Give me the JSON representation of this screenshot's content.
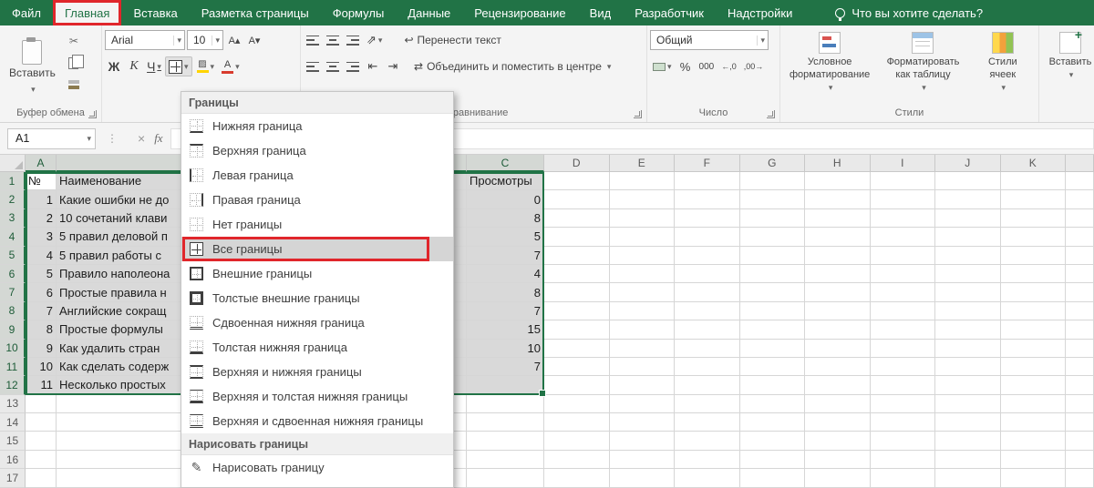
{
  "colors": {
    "excel_green": "#217346",
    "annotation_red": "#e0262b",
    "selection_gray": "#d9d9d9",
    "menu_selected_gray": "#d5d5d5"
  },
  "tabs": [
    {
      "label": "Файл"
    },
    {
      "label": "Главная",
      "active": true
    },
    {
      "label": "Вставка"
    },
    {
      "label": "Разметка страницы"
    },
    {
      "label": "Формулы"
    },
    {
      "label": "Данные"
    },
    {
      "label": "Рецензирование"
    },
    {
      "label": "Вид"
    },
    {
      "label": "Разработчик"
    },
    {
      "label": "Надстройки"
    }
  ],
  "tellme": {
    "label": "Что вы хотите сделать?",
    "icon": "lightbulb"
  },
  "icons": {
    "cut": "✂",
    "grow_font": "А▴",
    "shrink_font": "А▾",
    "orientation": "⇗",
    "wrap": "↩",
    "merge": "⇄",
    "indent_decrease": "⇤",
    "indent_increase": "⇥",
    "increase_decimal": "←,0",
    "decrease_decimal": ",00→",
    "cancel": "×",
    "dots": "⋮",
    "fx": "fx",
    "draw_pencil": "✎"
  },
  "ribbon": {
    "clipboard": {
      "label": "Буфер обмена",
      "paste_label": "Вставить"
    },
    "font": {
      "label": "Шрифт",
      "font_name": "Arial",
      "font_size": "10",
      "bold_label": "Ж",
      "italic_label": "К",
      "underline_label": "Ч"
    },
    "alignment": {
      "label": "Выравнивание",
      "wrap_label": "Перенести текст",
      "merge_label": "Объединить и поместить в центре"
    },
    "number": {
      "label": "Число",
      "format_value": "Общий",
      "percent_label": "%",
      "thousands_label": "000"
    },
    "styles": {
      "label": "Стили",
      "conditional_label": "Условное форматирование",
      "format_table_label": "Форматировать как таблицу",
      "cell_styles_label": "Стили ячеек"
    },
    "cells": {
      "insert_label": "Вставить"
    }
  },
  "name_box": {
    "value": "A1"
  },
  "borders_menu": {
    "header": "Границы",
    "items": [
      {
        "label": "Нижняя граница",
        "icon": "bottom"
      },
      {
        "label": "Верхняя граница",
        "icon": "top"
      },
      {
        "label": "Левая граница",
        "icon": "left"
      },
      {
        "label": "Правая граница",
        "icon": "right"
      },
      {
        "label": "Нет границы",
        "icon": "none"
      },
      {
        "label": "Все границы",
        "icon": "all",
        "selected": true
      },
      {
        "label": "Внешние границы",
        "icon": "outside"
      },
      {
        "label": "Толстые внешние границы",
        "icon": "thick-outside"
      },
      {
        "label": "Сдвоенная нижняя граница",
        "icon": "double-bottom"
      },
      {
        "label": "Толстая нижняя граница",
        "icon": "thick-bottom"
      },
      {
        "label": "Верхняя и нижняя границы",
        "icon": "top-bottom"
      },
      {
        "label": "Верхняя и толстая нижняя границы",
        "icon": "top-thick-bottom"
      },
      {
        "label": "Верхняя и сдвоенная нижняя границы",
        "icon": "top-double-bottom"
      }
    ],
    "section2_header": "Нарисовать границы",
    "items2": [
      {
        "label": "Нарисовать границу",
        "icon": "draw"
      }
    ]
  },
  "grid": {
    "columns": [
      "A",
      "B",
      "C",
      "D",
      "E",
      "F",
      "G",
      "H",
      "I",
      "J",
      "K"
    ],
    "rows": [
      {
        "n": "1",
        "a": "№",
        "b": "Наименование",
        "c": "Просмотры"
      },
      {
        "n": "2",
        "a": "1",
        "b": "Какие ошибки не до",
        "c": "0"
      },
      {
        "n": "3",
        "a": "2",
        "b": "10 сочетаний клави",
        "c": "8"
      },
      {
        "n": "4",
        "a": "3",
        "b": "5 правил деловой п",
        "c": "5"
      },
      {
        "n": "5",
        "a": "4",
        "b": "5 правил работы с",
        "c": "7"
      },
      {
        "n": "6",
        "a": "5",
        "b": "Правило наполеона",
        "c": "4"
      },
      {
        "n": "7",
        "a": "6",
        "b": "Простые правила н",
        "c": "8"
      },
      {
        "n": "8",
        "a": "7",
        "b": "Английские сокращ",
        "c": "7"
      },
      {
        "n": "9",
        "a": "8",
        "b": "Простые формулы",
        "c": "15"
      },
      {
        "n": "10",
        "a": "9",
        "b": "Как удалить стран",
        "c": "10"
      },
      {
        "n": "11",
        "a": "10",
        "b": "Как сделать содерж",
        "c": "7"
      },
      {
        "n": "12",
        "a": "11",
        "b": "Несколько простых",
        "c": ""
      },
      {
        "n": "13",
        "a": "",
        "b": "",
        "c": ""
      },
      {
        "n": "14",
        "a": "",
        "b": "",
        "c": ""
      },
      {
        "n": "15",
        "a": "",
        "b": "",
        "c": ""
      },
      {
        "n": "16",
        "a": "",
        "b": "",
        "c": ""
      },
      {
        "n": "17",
        "a": "",
        "b": "",
        "c": ""
      }
    ]
  }
}
